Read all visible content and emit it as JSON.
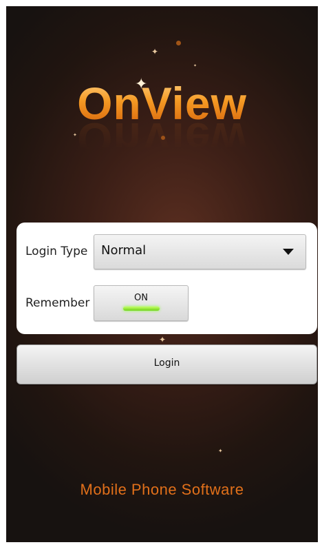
{
  "app": {
    "logo_text": "OnView",
    "footer_text": "Mobile Phone Software"
  },
  "login_form": {
    "login_type_label": "Login Type",
    "login_type_value": "Normal",
    "remember_label": "Remember",
    "remember_toggle_text": "ON",
    "remember_state": true
  },
  "actions": {
    "login_label": "Login"
  },
  "icons": {
    "dropdown": "caret-down-icon",
    "sparkles": "sparkle-icon"
  },
  "colors": {
    "logo_orange": "#f08a14",
    "footer_orange": "#e2701a",
    "toggle_green": "#7fe02a"
  }
}
